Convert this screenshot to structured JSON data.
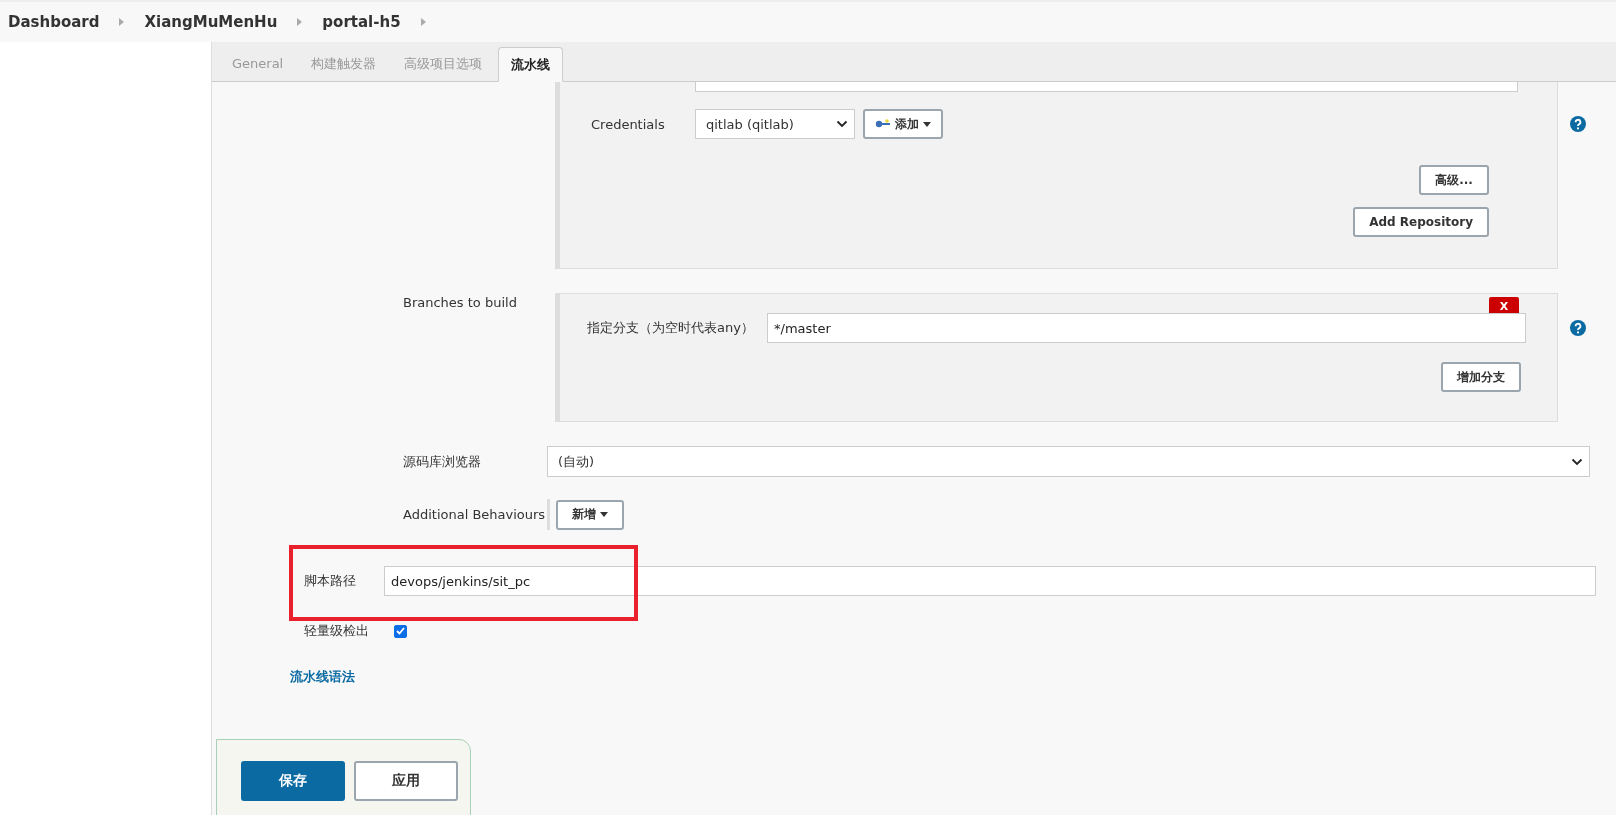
{
  "breadcrumbs": [
    {
      "label": "Dashboard"
    },
    {
      "label": "XiangMuMenHu"
    },
    {
      "label": "portal-h5"
    }
  ],
  "tabs": [
    {
      "label": "General",
      "selected": false
    },
    {
      "label": "构建触发器",
      "selected": false
    },
    {
      "label": "高级项目选项",
      "selected": false
    },
    {
      "label": "流水线",
      "selected": true
    }
  ],
  "repository": {
    "credentials_label": "Credentials",
    "credentials_value": "qitlab (qitlab)",
    "add_button": "添加",
    "advanced_button": "高级...",
    "add_repository_button": "Add Repository"
  },
  "branches": {
    "label": "Branches to build",
    "branch_label": "指定分支（为空时代表any）",
    "branch_value": "*/master",
    "delete_button": "X",
    "add_branch_button": "增加分支"
  },
  "browser": {
    "label": "源码库浏览器",
    "value": "(自动)"
  },
  "behaviours": {
    "label": "Additional Behaviours",
    "add_button": "新增"
  },
  "script_path": {
    "label": "脚本路径",
    "value": "devops/jenkins/sit_pc",
    "highlighted": true
  },
  "lightweight": {
    "label": "轻量级检出",
    "checked": true
  },
  "syntax_link": "流水线语法",
  "buttons": [
    {
      "label": "保存",
      "kind": "primary"
    },
    {
      "label": "应用",
      "kind": "secondary"
    }
  ]
}
